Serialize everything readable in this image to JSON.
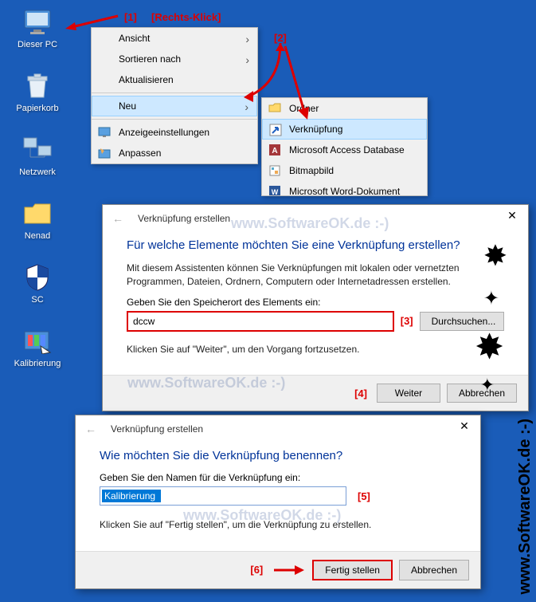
{
  "desktop": {
    "icons": [
      {
        "label": "Dieser PC"
      },
      {
        "label": "Papierkorb"
      },
      {
        "label": "Netzwerk"
      },
      {
        "label": "Nenad"
      },
      {
        "label": "SC"
      },
      {
        "label": "Kalibrierung"
      }
    ]
  },
  "annotations": {
    "n1": "[1]",
    "rechts": "[Rechts-Klick]",
    "n2": "[2]",
    "n3": "[3]",
    "n4": "[4]",
    "n5": "[5]",
    "n6": "[6]"
  },
  "ctx1": {
    "items": [
      "Ansicht",
      "Sortieren nach",
      "Aktualisieren",
      "Neu",
      "Anzeigeeinstellungen",
      "Anpassen"
    ]
  },
  "ctx2": {
    "items": [
      "Ordner",
      "Verknüpfung",
      "Microsoft Access Database",
      "Bitmapbild",
      "Microsoft Word-Dokument"
    ]
  },
  "dlg1": {
    "head": "Verknüpfung erstellen",
    "title": "Für welche Elemente möchten Sie eine Verknüpfung erstellen?",
    "desc": "Mit diesem Assistenten können Sie Verknüpfungen mit lokalen oder vernetzten Programmen, Dateien, Ordnern, Computern oder Internetadressen erstellen.",
    "label": "Geben Sie den Speicherort des Elements ein:",
    "value": "dccw",
    "browse": "Durchsuchen...",
    "hint": "Klicken Sie auf \"Weiter\", um den Vorgang fortzusetzen.",
    "next": "Weiter",
    "cancel": "Abbrechen"
  },
  "dlg2": {
    "head": "Verknüpfung erstellen",
    "title": "Wie möchten Sie die Verknüpfung benennen?",
    "label": "Geben Sie den Namen für die Verknüpfung ein:",
    "value": "Kalibrierung",
    "hint": "Klicken Sie auf \"Fertig stellen\", um die Verknüpfung zu erstellen.",
    "finish": "Fertig stellen",
    "cancel": "Abbrechen"
  },
  "watermark": "www.SoftwareOK.de :-)",
  "sidewm": "www.SoftwareOK.de :-)"
}
